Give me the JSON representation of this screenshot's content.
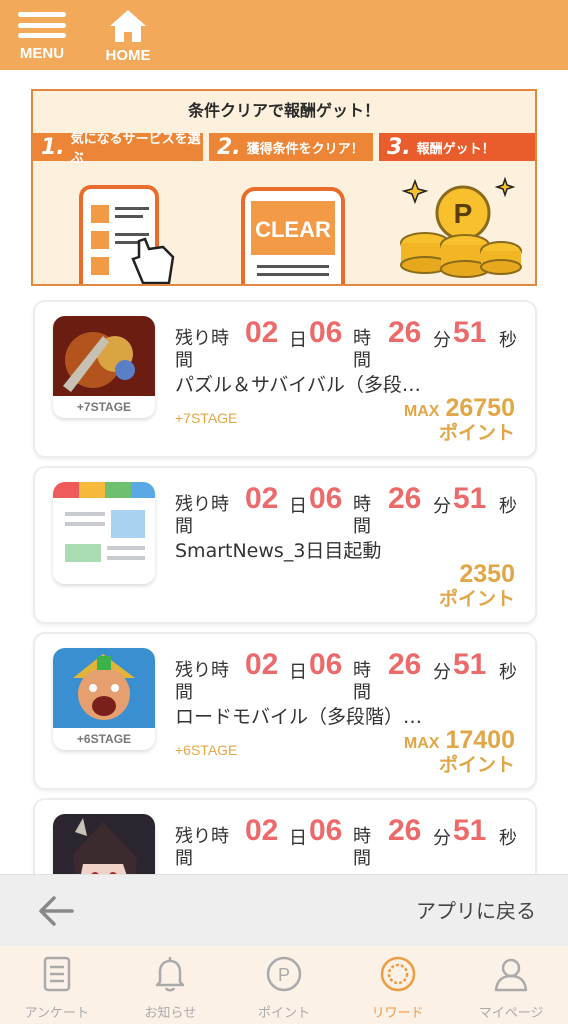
{
  "header": {
    "menu_label": "MENU",
    "home_label": "HOME"
  },
  "banner": {
    "title": "条件クリアで報酬ゲット！",
    "steps": [
      {
        "num": "1.",
        "text": "気になるサービスを選ぶ"
      },
      {
        "num": "2.",
        "text": "獲得条件をクリア！"
      },
      {
        "num": "3.",
        "text": "報酬ゲット！"
      }
    ],
    "clear_text": "CLEAR",
    "coin_letter": "P"
  },
  "timer_labels": {
    "prefix_top": "残り時",
    "prefix_bottom": "間",
    "day": "日",
    "hour_top": "時",
    "hour_bottom": "間",
    "minute": "分",
    "second": "秒"
  },
  "offers": [
    {
      "thumb_label": "+7STAGE",
      "days": "02",
      "hours": "06",
      "minutes": "26",
      "seconds": "51",
      "title": "パズル＆サバイバル（多段…",
      "stage_text": "+7STAGE",
      "max_label": "MAX",
      "points": "26750",
      "points_unit": "ポイント"
    },
    {
      "thumb_label": "",
      "days": "02",
      "hours": "06",
      "minutes": "26",
      "seconds": "51",
      "title": "SmartNews_3日目起動",
      "stage_text": "",
      "max_label": "",
      "points": "2350",
      "points_unit": "ポイント"
    },
    {
      "thumb_label": "+6STAGE",
      "days": "02",
      "hours": "06",
      "minutes": "26",
      "seconds": "51",
      "title": "ロードモバイル（多段階）…",
      "stage_text": "+6STAGE",
      "max_label": "MAX",
      "points": "17400",
      "points_unit": "ポイント"
    },
    {
      "thumb_label": "",
      "days": "02",
      "hours": "06",
      "minutes": "26",
      "seconds": "51",
      "title": "",
      "stage_text": "",
      "max_label": "",
      "points": "",
      "points_unit": ""
    }
  ],
  "back_bar": {
    "label": "アプリに戻る"
  },
  "tabs": [
    {
      "label": "アンケート",
      "icon": "survey-icon"
    },
    {
      "label": "お知らせ",
      "icon": "bell-icon"
    },
    {
      "label": "ポイント",
      "icon": "point-icon"
    },
    {
      "label": "リワード",
      "icon": "reward-icon",
      "active": true
    },
    {
      "label": "マイページ",
      "icon": "user-icon"
    }
  ],
  "colors": {
    "header": "#f2aa5a",
    "accent": "#ee9c40",
    "timer": "#ec6a6a",
    "points": "#e3a646"
  }
}
